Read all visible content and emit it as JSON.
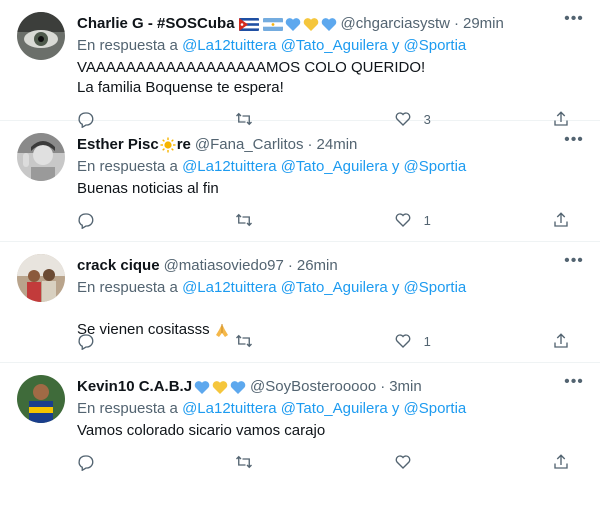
{
  "tweets": [
    {
      "name": "Charlie G - #SOSCuba",
      "handle": "@chgarciasystw",
      "time": "29min",
      "reply_prefix": "En respuesta a",
      "mentions": [
        "@La12tuittera",
        "@Tato_Aguilera",
        "@Sportia"
      ],
      "mention_joiner": "y",
      "text": "VAAAAAAAAAAAAAAAAAAMOS COLO QUERIDO!\nLa familia Boquense te espera!",
      "likes": "3"
    },
    {
      "name": "Esther Pisc",
      "name_suffix": "re",
      "handle": "@Fana_Carlitos",
      "time": "24min",
      "reply_prefix": "En respuesta a",
      "mentions": [
        "@La12tuittera",
        "@Tato_Aguilera",
        "@Sportia"
      ],
      "mention_joiner": "y",
      "text": "Buenas noticias al fin",
      "likes": "1"
    },
    {
      "name": "crack cique",
      "handle": "@matiasoviedo97",
      "time": "26min",
      "reply_prefix": "En respuesta a",
      "mentions": [
        "@La12tuittera",
        "@Tato_Aguilera",
        "@Sportia"
      ],
      "mention_joiner": "y",
      "text": "Se vienen cositasss",
      "likes": "1"
    },
    {
      "name": "Kevin10 C.A.B.J",
      "handle": "@SoyBosterooooo",
      "time": "3min",
      "reply_prefix": "En respuesta a",
      "mentions": [
        "@La12tuittera",
        "@Tato_Aguilera",
        "@Sportia"
      ],
      "mention_joiner": "y",
      "text": "Vamos colorado sicario vamos carajo",
      "likes": ""
    }
  ],
  "dot_separator": "·",
  "colors": {
    "link": "#1d9bf0",
    "muted": "#536471",
    "text": "#0f1419",
    "border": "#eff3f4"
  },
  "icons": [
    "reply-icon",
    "retweet-icon",
    "like-icon",
    "share-icon",
    "more-icon"
  ]
}
